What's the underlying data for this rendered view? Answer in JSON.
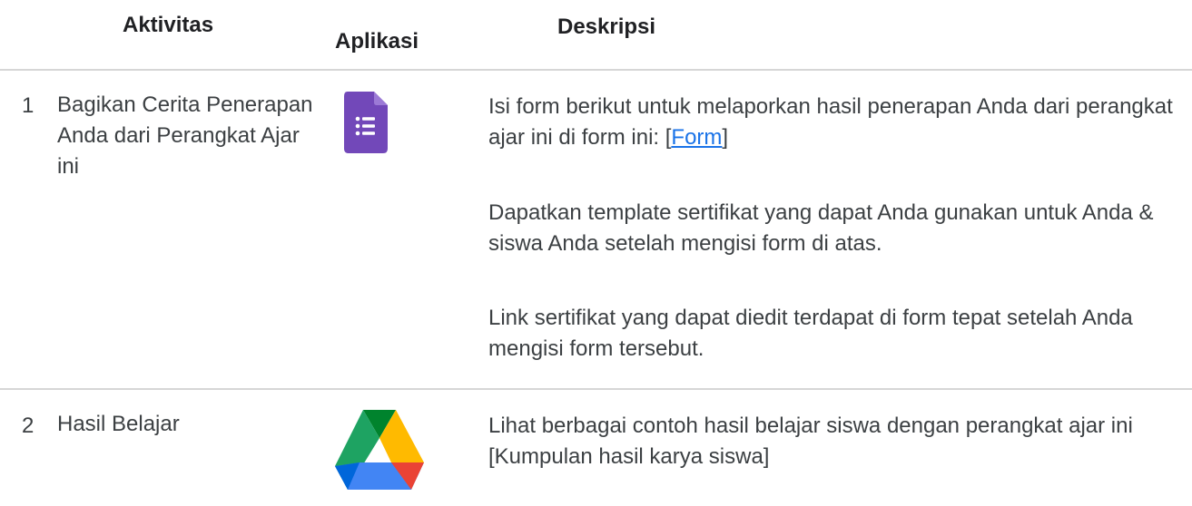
{
  "headers": {
    "activity": "Aktivitas",
    "app": "Aplikasi",
    "description": "Deskripsi"
  },
  "rows": [
    {
      "number": "1",
      "activity": "Bagikan Cerita Penerapan Anda dari Perangkat Ajar ini",
      "app_icon": "google-forms-icon",
      "desc1_before": "Isi form berikut untuk melaporkan hasil penerapan Anda dari perangkat ajar ini di form ini: [",
      "desc1_link": "Form",
      "desc1_after": "]",
      "desc2": "Dapatkan template sertifikat yang dapat Anda gunakan untuk Anda & siswa Anda setelah mengisi form di atas.",
      "desc3": "Link sertifikat yang dapat diedit terdapat di form tepat setelah Anda mengisi form tersebut."
    },
    {
      "number": "2",
      "activity": "Hasil Belajar",
      "app_icon": "google-drive-icon",
      "desc1": "Lihat berbagai contoh hasil belajar siswa dengan perangkat ajar ini [Kumpulan hasil karya siswa]"
    }
  ],
  "colors": {
    "forms_purple": "#7248b9",
    "link_blue": "#1a73e8",
    "drive_green": "#1ea362",
    "drive_yellow": "#ffba00",
    "drive_blue": "#4285f4",
    "drive_red": "#ea4335",
    "drive_darkgreen": "#00832d",
    "drive_darkblue": "#0066da"
  }
}
